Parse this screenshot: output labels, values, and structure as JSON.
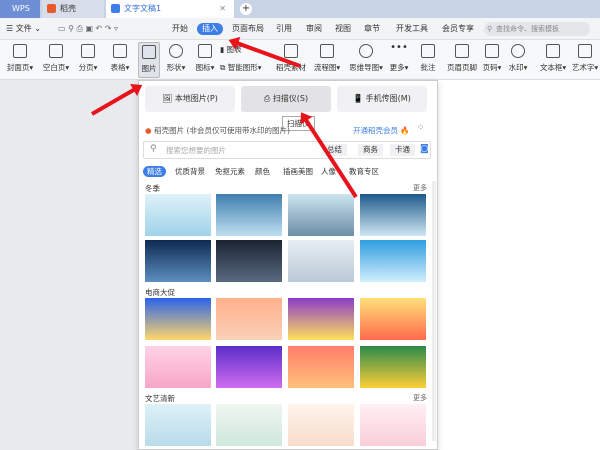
{
  "tabs": [
    {
      "label": "WPS"
    },
    {
      "label": "稻壳"
    },
    {
      "label": "文字文稿1"
    }
  ],
  "menu": {
    "file": "文件",
    "items": [
      "开始",
      "插入",
      "页面布局",
      "引用",
      "审阅",
      "视图",
      "章节",
      "开发工具",
      "会员专享"
    ],
    "search_placeholder": "查找命令、搜索模板"
  },
  "ribbon": [
    "封面页",
    "空白页",
    "分页",
    "表格",
    "图片",
    "形状",
    "图标",
    "图表",
    "智能图形",
    "稻壳素材",
    "流程图",
    "思维导图",
    "更多",
    "批注",
    "页眉页脚",
    "页码",
    "水印",
    "文本框",
    "艺术字"
  ],
  "panel": {
    "buttons": [
      "本地图片(P)",
      "扫描仪(S)",
      "手机传图(M)"
    ],
    "tooltip": "扫描仪",
    "header_brand": "稻壳图片",
    "header_note": "(非会员仅可使用带水印的图片)",
    "vip_link": "开通稻壳会员",
    "search_placeholder": "搜索您想要的图片",
    "search_tags": [
      "总结",
      "商务",
      "卡通"
    ],
    "categories": [
      "精选",
      "优质背景",
      "免抠元素",
      "颜色",
      "插画美图",
      "人像",
      "教育专区"
    ],
    "sections": [
      {
        "title": "冬季",
        "more": "更多"
      },
      {
        "title": "电商大促",
        "more": ""
      },
      {
        "title": "文艺清新",
        "more": "更多"
      }
    ]
  },
  "colors": {
    "accent": "#3d7ee8",
    "arrow": "#e8131b"
  }
}
